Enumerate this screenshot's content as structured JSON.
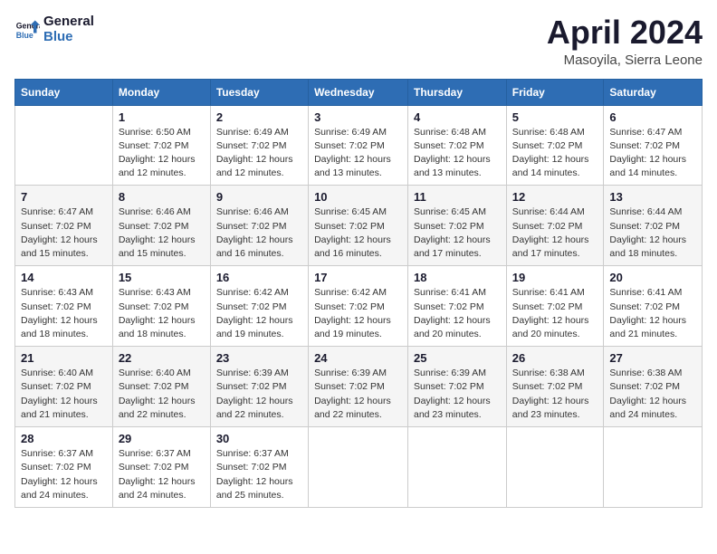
{
  "logo": {
    "line1": "General",
    "line2": "Blue"
  },
  "header": {
    "month": "April 2024",
    "location": "Masoyila, Sierra Leone"
  },
  "weekdays": [
    "Sunday",
    "Monday",
    "Tuesday",
    "Wednesday",
    "Thursday",
    "Friday",
    "Saturday"
  ],
  "weeks": [
    [
      {
        "day": "",
        "sunrise": "",
        "sunset": "",
        "daylight": ""
      },
      {
        "day": "1",
        "sunrise": "Sunrise: 6:50 AM",
        "sunset": "Sunset: 7:02 PM",
        "daylight": "Daylight: 12 hours and 12 minutes."
      },
      {
        "day": "2",
        "sunrise": "Sunrise: 6:49 AM",
        "sunset": "Sunset: 7:02 PM",
        "daylight": "Daylight: 12 hours and 12 minutes."
      },
      {
        "day": "3",
        "sunrise": "Sunrise: 6:49 AM",
        "sunset": "Sunset: 7:02 PM",
        "daylight": "Daylight: 12 hours and 13 minutes."
      },
      {
        "day": "4",
        "sunrise": "Sunrise: 6:48 AM",
        "sunset": "Sunset: 7:02 PM",
        "daylight": "Daylight: 12 hours and 13 minutes."
      },
      {
        "day": "5",
        "sunrise": "Sunrise: 6:48 AM",
        "sunset": "Sunset: 7:02 PM",
        "daylight": "Daylight: 12 hours and 14 minutes."
      },
      {
        "day": "6",
        "sunrise": "Sunrise: 6:47 AM",
        "sunset": "Sunset: 7:02 PM",
        "daylight": "Daylight: 12 hours and 14 minutes."
      }
    ],
    [
      {
        "day": "7",
        "sunrise": "Sunrise: 6:47 AM",
        "sunset": "Sunset: 7:02 PM",
        "daylight": "Daylight: 12 hours and 15 minutes."
      },
      {
        "day": "8",
        "sunrise": "Sunrise: 6:46 AM",
        "sunset": "Sunset: 7:02 PM",
        "daylight": "Daylight: 12 hours and 15 minutes."
      },
      {
        "day": "9",
        "sunrise": "Sunrise: 6:46 AM",
        "sunset": "Sunset: 7:02 PM",
        "daylight": "Daylight: 12 hours and 16 minutes."
      },
      {
        "day": "10",
        "sunrise": "Sunrise: 6:45 AM",
        "sunset": "Sunset: 7:02 PM",
        "daylight": "Daylight: 12 hours and 16 minutes."
      },
      {
        "day": "11",
        "sunrise": "Sunrise: 6:45 AM",
        "sunset": "Sunset: 7:02 PM",
        "daylight": "Daylight: 12 hours and 17 minutes."
      },
      {
        "day": "12",
        "sunrise": "Sunrise: 6:44 AM",
        "sunset": "Sunset: 7:02 PM",
        "daylight": "Daylight: 12 hours and 17 minutes."
      },
      {
        "day": "13",
        "sunrise": "Sunrise: 6:44 AM",
        "sunset": "Sunset: 7:02 PM",
        "daylight": "Daylight: 12 hours and 18 minutes."
      }
    ],
    [
      {
        "day": "14",
        "sunrise": "Sunrise: 6:43 AM",
        "sunset": "Sunset: 7:02 PM",
        "daylight": "Daylight: 12 hours and 18 minutes."
      },
      {
        "day": "15",
        "sunrise": "Sunrise: 6:43 AM",
        "sunset": "Sunset: 7:02 PM",
        "daylight": "Daylight: 12 hours and 18 minutes."
      },
      {
        "day": "16",
        "sunrise": "Sunrise: 6:42 AM",
        "sunset": "Sunset: 7:02 PM",
        "daylight": "Daylight: 12 hours and 19 minutes."
      },
      {
        "day": "17",
        "sunrise": "Sunrise: 6:42 AM",
        "sunset": "Sunset: 7:02 PM",
        "daylight": "Daylight: 12 hours and 19 minutes."
      },
      {
        "day": "18",
        "sunrise": "Sunrise: 6:41 AM",
        "sunset": "Sunset: 7:02 PM",
        "daylight": "Daylight: 12 hours and 20 minutes."
      },
      {
        "day": "19",
        "sunrise": "Sunrise: 6:41 AM",
        "sunset": "Sunset: 7:02 PM",
        "daylight": "Daylight: 12 hours and 20 minutes."
      },
      {
        "day": "20",
        "sunrise": "Sunrise: 6:41 AM",
        "sunset": "Sunset: 7:02 PM",
        "daylight": "Daylight: 12 hours and 21 minutes."
      }
    ],
    [
      {
        "day": "21",
        "sunrise": "Sunrise: 6:40 AM",
        "sunset": "Sunset: 7:02 PM",
        "daylight": "Daylight: 12 hours and 21 minutes."
      },
      {
        "day": "22",
        "sunrise": "Sunrise: 6:40 AM",
        "sunset": "Sunset: 7:02 PM",
        "daylight": "Daylight: 12 hours and 22 minutes."
      },
      {
        "day": "23",
        "sunrise": "Sunrise: 6:39 AM",
        "sunset": "Sunset: 7:02 PM",
        "daylight": "Daylight: 12 hours and 22 minutes."
      },
      {
        "day": "24",
        "sunrise": "Sunrise: 6:39 AM",
        "sunset": "Sunset: 7:02 PM",
        "daylight": "Daylight: 12 hours and 22 minutes."
      },
      {
        "day": "25",
        "sunrise": "Sunrise: 6:39 AM",
        "sunset": "Sunset: 7:02 PM",
        "daylight": "Daylight: 12 hours and 23 minutes."
      },
      {
        "day": "26",
        "sunrise": "Sunrise: 6:38 AM",
        "sunset": "Sunset: 7:02 PM",
        "daylight": "Daylight: 12 hours and 23 minutes."
      },
      {
        "day": "27",
        "sunrise": "Sunrise: 6:38 AM",
        "sunset": "Sunset: 7:02 PM",
        "daylight": "Daylight: 12 hours and 24 minutes."
      }
    ],
    [
      {
        "day": "28",
        "sunrise": "Sunrise: 6:37 AM",
        "sunset": "Sunset: 7:02 PM",
        "daylight": "Daylight: 12 hours and 24 minutes."
      },
      {
        "day": "29",
        "sunrise": "Sunrise: 6:37 AM",
        "sunset": "Sunset: 7:02 PM",
        "daylight": "Daylight: 12 hours and 24 minutes."
      },
      {
        "day": "30",
        "sunrise": "Sunrise: 6:37 AM",
        "sunset": "Sunset: 7:02 PM",
        "daylight": "Daylight: 12 hours and 25 minutes."
      },
      {
        "day": "",
        "sunrise": "",
        "sunset": "",
        "daylight": ""
      },
      {
        "day": "",
        "sunrise": "",
        "sunset": "",
        "daylight": ""
      },
      {
        "day": "",
        "sunrise": "",
        "sunset": "",
        "daylight": ""
      },
      {
        "day": "",
        "sunrise": "",
        "sunset": "",
        "daylight": ""
      }
    ]
  ]
}
